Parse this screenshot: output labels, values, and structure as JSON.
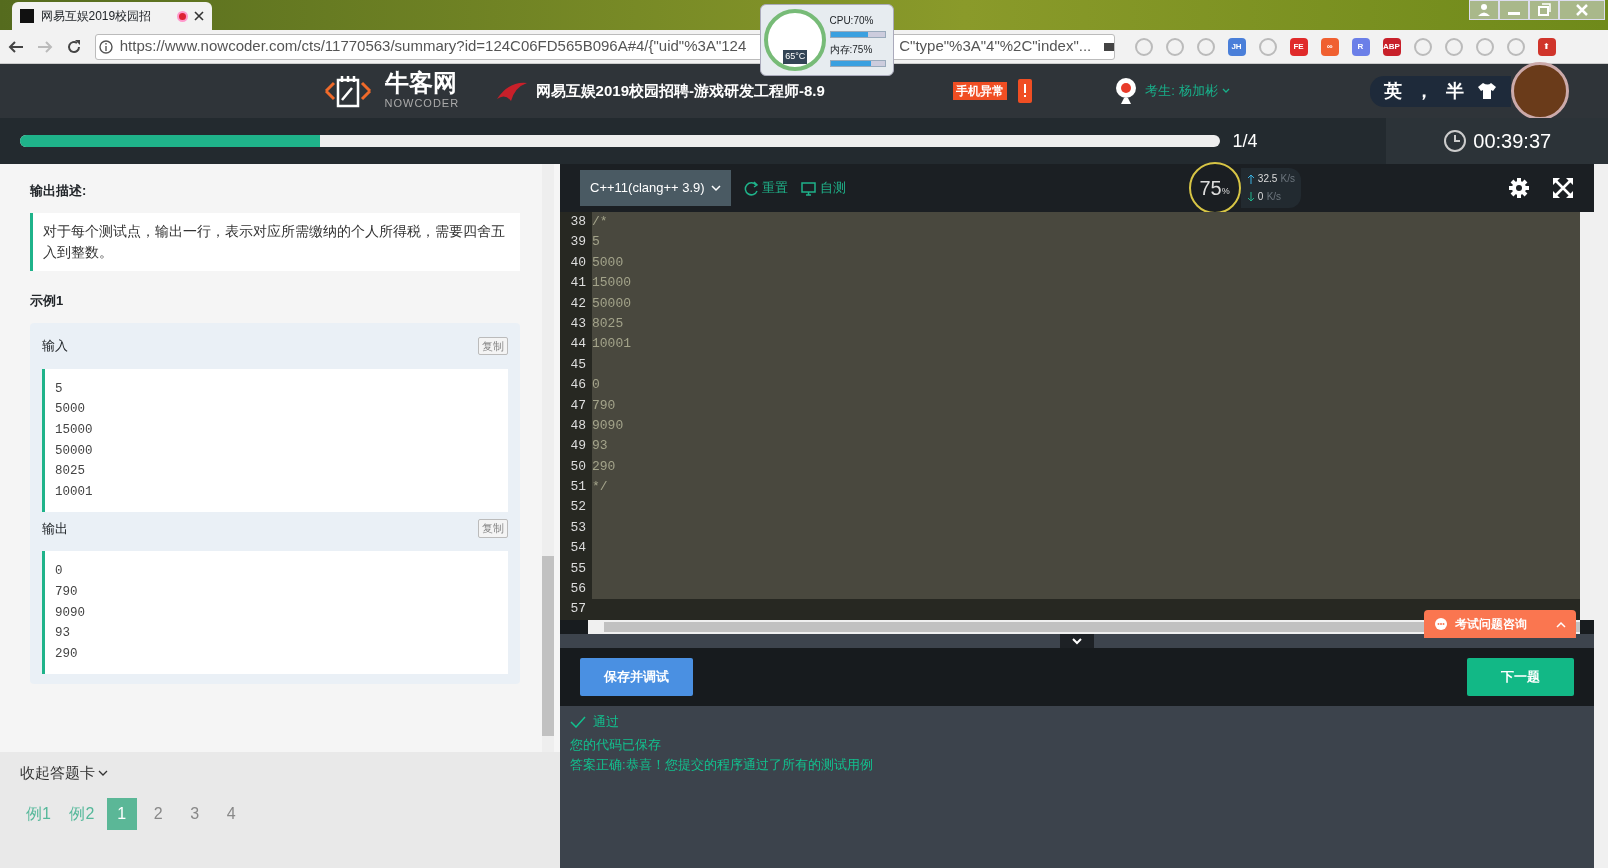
{
  "browser": {
    "tab": {
      "title": "网易互娱2019校园招"
    },
    "url_start": "https://www.nowcoder.com/cts/11770563/summary?id=124C06FD565B096A#4/{\"uid\"%3A\"124",
    "url_end": "C\"type\"%3A\"4\"%2C\"index\"...",
    "extensions": [
      {
        "kind": "glyph"
      },
      {
        "kind": "glyph"
      },
      {
        "kind": "glyph"
      },
      {
        "kind": "badge",
        "label": "JH",
        "color": "#4a7fd9"
      },
      {
        "kind": "glyph"
      },
      {
        "kind": "badge",
        "label": "FE",
        "color": "#e02a2a"
      },
      {
        "kind": "badge",
        "label": "∞",
        "color": "#f06030"
      },
      {
        "kind": "badge",
        "label": "R",
        "color": "#6b7fe8"
      },
      {
        "kind": "badge",
        "label": "ABP",
        "color": "#c8202a"
      },
      {
        "kind": "glyph"
      },
      {
        "kind": "glyph"
      },
      {
        "kind": "glyph"
      },
      {
        "kind": "glyph"
      },
      {
        "kind": "badge",
        "label": "⬆",
        "color": "#d0352b"
      }
    ]
  },
  "monitor": {
    "cpu": {
      "label": "CPU:70%",
      "level": 0.7
    },
    "memory": {
      "label": "内存:75%",
      "level": 0.75
    },
    "temperature": "65°C"
  },
  "header": {
    "logo": "牛客网",
    "logo_sub": "NOWCODER",
    "exam_title": "网易互娱2019校园招聘-游戏研发工程师-8.9",
    "alert": "手机异常",
    "candidate": "考生: 杨加彬",
    "ime": [
      "英",
      "，",
      "半"
    ]
  },
  "progress": {
    "level": 0.25,
    "count": "1/4",
    "timer": "00:39:37"
  },
  "problem": {
    "section_title": "输出描述:",
    "description": "对于每个测试点，输出一行，表示对应所需缴纳的个人所得税，需要四舍五入到整数。",
    "example_title": "示例1",
    "blocks": [
      {
        "label": "输入",
        "copy": "复制",
        "lines": [
          "5",
          "5000",
          "15000",
          "50000",
          "8025",
          "10001"
        ]
      },
      {
        "label": "输出",
        "copy": "复制",
        "lines": [
          "0",
          "790",
          "9090",
          "93",
          "290"
        ]
      }
    ]
  },
  "answer_card": {
    "toggle": "收起答题卡",
    "items": [
      {
        "label": "例1",
        "kind": "example",
        "selected": false
      },
      {
        "label": "例2",
        "kind": "example",
        "selected": false
      },
      {
        "label": "1",
        "kind": "question",
        "selected": true
      },
      {
        "label": "2",
        "kind": "question",
        "selected": false
      },
      {
        "label": "3",
        "kind": "question",
        "selected": false
      },
      {
        "label": "4",
        "kind": "question",
        "selected": false
      }
    ]
  },
  "editor": {
    "language": "C++11(clang++ 3.9)",
    "actions": [
      "重置",
      "自测"
    ],
    "network": {
      "percent": "75",
      "percent_unit": "%",
      "up": "32.5",
      "up_unit": "K/s",
      "down": "0",
      "down_unit": "K/s"
    },
    "lines": [
      {
        "n": "38",
        "text": "/*",
        "selected": true
      },
      {
        "n": "39",
        "text": "5",
        "selected": true
      },
      {
        "n": "40",
        "text": "5000",
        "selected": true
      },
      {
        "n": "41",
        "text": "15000",
        "selected": true
      },
      {
        "n": "42",
        "text": "50000",
        "selected": true
      },
      {
        "n": "43",
        "text": "8025",
        "selected": true
      },
      {
        "n": "44",
        "text": "10001",
        "selected": true
      },
      {
        "n": "45",
        "selected": true
      },
      {
        "n": "46",
        "text": "0",
        "selected": true
      },
      {
        "n": "47",
        "text": "790",
        "selected": true
      },
      {
        "n": "48",
        "text": "9090",
        "selected": true
      },
      {
        "n": "49",
        "text": "93",
        "selected": true
      },
      {
        "n": "50",
        "text": "290",
        "selected": true
      },
      {
        "n": "51",
        "text": "*/",
        "selected": true
      },
      {
        "n": "52",
        "selected": true
      },
      {
        "n": "53",
        "selected": true
      },
      {
        "n": "54",
        "selected": true
      },
      {
        "n": "55",
        "selected": true
      },
      {
        "n": "56",
        "selected": true
      },
      {
        "n": "57",
        "selected": false
      }
    ],
    "consult": "考试问题咨询",
    "save_button": "保存并调试",
    "next_button": "下一题",
    "result": {
      "status": "通过",
      "messages": [
        "您的代码已保存",
        "答案正确:恭喜！您提交的程序通过了所有的测试用例"
      ]
    }
  }
}
